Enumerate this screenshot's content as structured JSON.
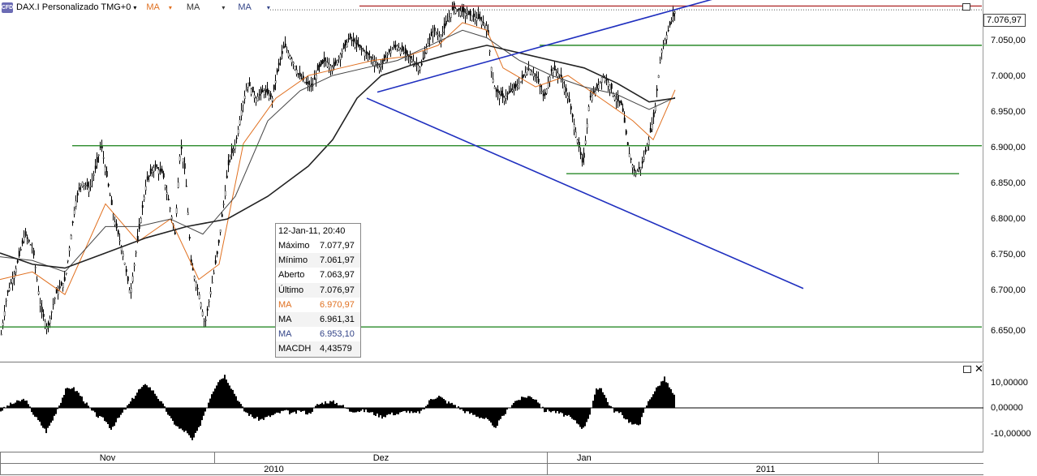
{
  "toolbar": {
    "logo_text": "CFD",
    "title": "DAX.I Personalizado TMG+0",
    "ma1_label": "MA",
    "ma2_label": "MA",
    "ma3_label": "MA",
    "colors": {
      "ma1": "#e07020",
      "ma2": "#333333",
      "ma3": "#334488"
    }
  },
  "last_price": "7.076,97",
  "info_box": {
    "header": "12-Jan-11, 20:40",
    "rows": [
      {
        "label": "Máximo",
        "value": "7.077,97",
        "color": "#000000"
      },
      {
        "label": "Mínimo",
        "value": "7.061,97",
        "color": "#000000"
      },
      {
        "label": "Aberto",
        "value": "7.063,97",
        "color": "#000000"
      },
      {
        "label": "Último",
        "value": "7.076,97",
        "color": "#000000"
      },
      {
        "label": "MA",
        "value": "6.970,97",
        "color": "#e07020"
      },
      {
        "label": "MA",
        "value": "6.961,31",
        "color": "#000000"
      },
      {
        "label": "MA",
        "value": "6.953,10",
        "color": "#334488"
      },
      {
        "label": "MACDH",
        "value": "4,43579",
        "color": "#000000"
      }
    ]
  },
  "time_axis": {
    "months": [
      "Nov",
      "Dez",
      "Jan"
    ],
    "years": [
      "2010",
      "2011"
    ]
  },
  "chart_data": [
    {
      "type": "candlestick",
      "title": "DAX.I Personalizado TMG+0",
      "y_ticks": [
        "7.050,00",
        "7.000,00",
        "6.950,00",
        "6.900,00",
        "6.850,00",
        "6.800,00",
        "6.750,00",
        "6.700,00",
        "6.650,00"
      ],
      "ylim": [
        6610,
        7090
      ],
      "price_path": [
        [
          0,
          6640
        ],
        [
          8,
          6700
        ],
        [
          18,
          6730
        ],
        [
          30,
          6780
        ],
        [
          40,
          6760
        ],
        [
          50,
          6680
        ],
        [
          58,
          6655
        ],
        [
          68,
          6700
        ],
        [
          80,
          6720
        ],
        [
          92,
          6820
        ],
        [
          100,
          6850
        ],
        [
          110,
          6840
        ],
        [
          118,
          6870
        ],
        [
          124,
          6900
        ],
        [
          132,
          6850
        ],
        [
          140,
          6800
        ],
        [
          150,
          6760
        ],
        [
          160,
          6700
        ],
        [
          170,
          6780
        ],
        [
          180,
          6850
        ],
        [
          190,
          6870
        ],
        [
          200,
          6860
        ],
        [
          208,
          6820
        ],
        [
          215,
          6780
        ],
        [
          222,
          6900
        ],
        [
          228,
          6860
        ],
        [
          235,
          6740
        ],
        [
          245,
          6700
        ],
        [
          252,
          6660
        ],
        [
          260,
          6710
        ],
        [
          268,
          6760
        ],
        [
          275,
          6820
        ],
        [
          282,
          6880
        ],
        [
          290,
          6900
        ],
        [
          298,
          6950
        ],
        [
          305,
          6980
        ],
        [
          315,
          6960
        ],
        [
          325,
          6970
        ],
        [
          335,
          6960
        ],
        [
          342,
          7000
        ],
        [
          350,
          7030
        ],
        [
          360,
          7010
        ],
        [
          368,
          6990
        ],
        [
          376,
          6980
        ],
        [
          384,
          6975
        ],
        [
          392,
          7000
        ],
        [
          400,
          7010
        ],
        [
          410,
          7000
        ],
        [
          420,
          7020
        ],
        [
          430,
          7040
        ],
        [
          440,
          7030
        ],
        [
          450,
          7020
        ],
        [
          460,
          7010
        ],
        [
          468,
          7000
        ],
        [
          478,
          7020
        ],
        [
          488,
          7030
        ],
        [
          498,
          7020
        ],
        [
          508,
          7010
        ],
        [
          518,
          7000
        ],
        [
          526,
          7030
        ],
        [
          534,
          7050
        ],
        [
          542,
          7040
        ],
        [
          550,
          7060
        ],
        [
          558,
          7080
        ],
        [
          568,
          7075
        ],
        [
          578,
          7070
        ],
        [
          590,
          7065
        ],
        [
          600,
          7055
        ],
        [
          606,
          6990
        ],
        [
          610,
          6970
        ],
        [
          620,
          6960
        ],
        [
          630,
          6970
        ],
        [
          640,
          6980
        ],
        [
          650,
          7000
        ],
        [
          660,
          6990
        ],
        [
          670,
          6960
        ],
        [
          680,
          7000
        ],
        [
          690,
          6990
        ],
        [
          700,
          6960
        ],
        [
          710,
          6910
        ],
        [
          718,
          6870
        ],
        [
          726,
          6960
        ],
        [
          734,
          6970
        ],
        [
          742,
          6990
        ],
        [
          750,
          6980
        ],
        [
          758,
          6960
        ],
        [
          766,
          6950
        ],
        [
          774,
          6890
        ],
        [
          782,
          6860
        ],
        [
          790,
          6870
        ],
        [
          798,
          6900
        ],
        [
          806,
          6940
        ],
        [
          814,
          7020
        ],
        [
          820,
          7040
        ],
        [
          826,
          7060
        ],
        [
          832,
          7077
        ]
      ],
      "ma_series": [
        {
          "name": "MA",
          "color": "#e07020",
          "values": [
            [
              0,
              6720
            ],
            [
              40,
              6730
            ],
            [
              80,
              6700
            ],
            [
              130,
              6820
            ],
            [
              170,
              6770
            ],
            [
              210,
              6800
            ],
            [
              245,
              6720
            ],
            [
              270,
              6740
            ],
            [
              300,
              6900
            ],
            [
              340,
              6960
            ],
            [
              380,
              6990
            ],
            [
              420,
              7000
            ],
            [
              460,
              7010
            ],
            [
              500,
              7015
            ],
            [
              540,
              7030
            ],
            [
              570,
              7060
            ],
            [
              600,
              7050
            ],
            [
              620,
              7000
            ],
            [
              660,
              6975
            ],
            [
              700,
              6990
            ],
            [
              740,
              6960
            ],
            [
              780,
              6930
            ],
            [
              805,
              6905
            ],
            [
              832,
              6971
            ]
          ]
        },
        {
          "name": "MA",
          "color": "#444444",
          "values": [
            [
              0,
              6750
            ],
            [
              40,
              6745
            ],
            [
              80,
              6730
            ],
            [
              130,
              6790
            ],
            [
              170,
              6790
            ],
            [
              210,
              6800
            ],
            [
              250,
              6780
            ],
            [
              290,
              6830
            ],
            [
              330,
              6930
            ],
            [
              370,
              6970
            ],
            [
              410,
              6990
            ],
            [
              450,
              7000
            ],
            [
              490,
              7010
            ],
            [
              530,
              7030
            ],
            [
              570,
              7050
            ],
            [
              600,
              7040
            ],
            [
              640,
              7010
            ],
            [
              680,
              6990
            ],
            [
              720,
              6975
            ],
            [
              760,
              6965
            ],
            [
              800,
              6945
            ],
            [
              832,
              6961
            ]
          ]
        },
        {
          "name": "MA",
          "color": "#222222",
          "values": [
            [
              0,
              6755
            ],
            [
              40,
              6740
            ],
            [
              80,
              6735
            ],
            [
              130,
              6755
            ],
            [
              180,
              6775
            ],
            [
              230,
              6790
            ],
            [
              280,
              6800
            ],
            [
              330,
              6830
            ],
            [
              380,
              6870
            ],
            [
              410,
              6905
            ],
            [
              440,
              6960
            ],
            [
              470,
              6990
            ],
            [
              510,
              7005
            ],
            [
              560,
              7020
            ],
            [
              600,
              7030
            ],
            [
              640,
              7020
            ],
            [
              680,
              7010
            ],
            [
              720,
              7000
            ],
            [
              760,
              6980
            ],
            [
              800,
              6955
            ],
            [
              832,
              6960
            ]
          ]
        }
      ],
      "horizontal_lines": [
        {
          "y": 7082,
          "x_start": 443,
          "x_end": 1210,
          "color": "#b03030"
        },
        {
          "y": 7030,
          "x_start": 665,
          "x_end": 1210,
          "color": "#2a8a2a"
        },
        {
          "y": 6897,
          "x_start": 89,
          "x_end": 1210,
          "color": "#2a8a2a"
        },
        {
          "y": 6860,
          "x_start": 698,
          "x_end": 1182,
          "color": "#2a8a2a"
        },
        {
          "y": 6657,
          "x_start": 0,
          "x_end": 1210,
          "color": "#2a8a2a"
        }
      ],
      "trend_lines": [
        {
          "x1": 465,
          "y1": 6968,
          "x2": 905,
          "y2": 7099,
          "color": "#1f2fbf"
        },
        {
          "x1": 452,
          "y1": 6960,
          "x2": 990,
          "y2": 6708,
          "color": "#1f2fbf"
        }
      ]
    },
    {
      "type": "bar",
      "title": "MACDH",
      "y_ticks": [
        "10,00000",
        "0,00000",
        "-10,00000"
      ],
      "ylim": [
        -15,
        15
      ],
      "histogram_path": [
        [
          0,
          -1
        ],
        [
          10,
          1
        ],
        [
          20,
          2
        ],
        [
          30,
          3
        ],
        [
          40,
          -2
        ],
        [
          48,
          -5
        ],
        [
          56,
          -8
        ],
        [
          64,
          -4
        ],
        [
          72,
          1
        ],
        [
          80,
          6
        ],
        [
          88,
          7
        ],
        [
          96,
          5
        ],
        [
          104,
          2
        ],
        [
          112,
          -1
        ],
        [
          120,
          -3
        ],
        [
          128,
          -4
        ],
        [
          136,
          -7
        ],
        [
          144,
          -4
        ],
        [
          152,
          -1
        ],
        [
          160,
          2
        ],
        [
          170,
          6
        ],
        [
          180,
          8
        ],
        [
          190,
          5
        ],
        [
          200,
          1
        ],
        [
          210,
          -4
        ],
        [
          220,
          -7
        ],
        [
          228,
          -8
        ],
        [
          236,
          -11
        ],
        [
          244,
          -7
        ],
        [
          252,
          -1
        ],
        [
          260,
          5
        ],
        [
          268,
          9
        ],
        [
          276,
          11
        ],
        [
          284,
          7
        ],
        [
          292,
          3
        ],
        [
          300,
          -1
        ],
        [
          310,
          -3
        ],
        [
          320,
          -4
        ],
        [
          330,
          -3
        ],
        [
          340,
          -2
        ],
        [
          350,
          -1
        ],
        [
          360,
          -2
        ],
        [
          370,
          -1
        ],
        [
          380,
          -2
        ],
        [
          390,
          1
        ],
        [
          400,
          2
        ],
        [
          410,
          2
        ],
        [
          420,
          1
        ],
        [
          430,
          -1
        ],
        [
          440,
          -1
        ],
        [
          450,
          -1
        ],
        [
          460,
          -2
        ],
        [
          470,
          -3
        ],
        [
          480,
          -2
        ],
        [
          490,
          -2
        ],
        [
          500,
          -1
        ],
        [
          510,
          -2
        ],
        [
          520,
          -1
        ],
        [
          530,
          3
        ],
        [
          540,
          4
        ],
        [
          550,
          2
        ],
        [
          560,
          1
        ],
        [
          570,
          -1
        ],
        [
          580,
          -2
        ],
        [
          590,
          -3
        ],
        [
          600,
          -4
        ],
        [
          608,
          -7
        ],
        [
          616,
          -4
        ],
        [
          624,
          -1
        ],
        [
          632,
          2
        ],
        [
          640,
          3
        ],
        [
          650,
          4
        ],
        [
          660,
          3
        ],
        [
          670,
          -1
        ],
        [
          680,
          -1
        ],
        [
          690,
          -2
        ],
        [
          700,
          -3
        ],
        [
          710,
          -5
        ],
        [
          718,
          -7
        ],
        [
          726,
          -2
        ],
        [
          734,
          6
        ],
        [
          740,
          7
        ],
        [
          748,
          2
        ],
        [
          756,
          -1
        ],
        [
          764,
          -2
        ],
        [
          772,
          -4
        ],
        [
          780,
          -6
        ],
        [
          788,
          -5
        ],
        [
          796,
          1
        ],
        [
          804,
          5
        ],
        [
          812,
          8
        ],
        [
          818,
          10
        ],
        [
          824,
          7
        ],
        [
          830,
          4
        ]
      ]
    }
  ]
}
